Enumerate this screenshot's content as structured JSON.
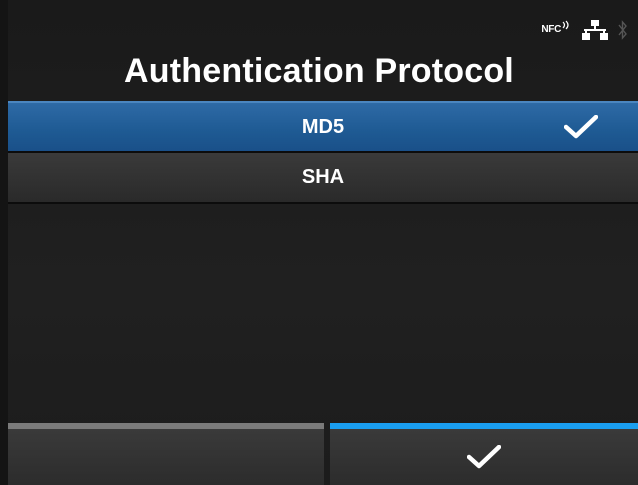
{
  "status_bar": {
    "nfc_label": "NFC",
    "icons": [
      "nfc-icon",
      "lan-icon",
      "bluetooth-icon"
    ]
  },
  "screen": {
    "title": "Authentication Protocol"
  },
  "options": [
    {
      "label": "MD5",
      "selected": true
    },
    {
      "label": "SHA",
      "selected": false
    }
  ],
  "footer": {
    "left_button_icon": "",
    "right_button_icon": "check-icon",
    "left_indicator_color": "#7b7b7b",
    "right_indicator_color": "#1a9ef0"
  },
  "colors": {
    "selection": "#1e5a93",
    "background": "#1b1b1b",
    "text": "#ffffff"
  }
}
